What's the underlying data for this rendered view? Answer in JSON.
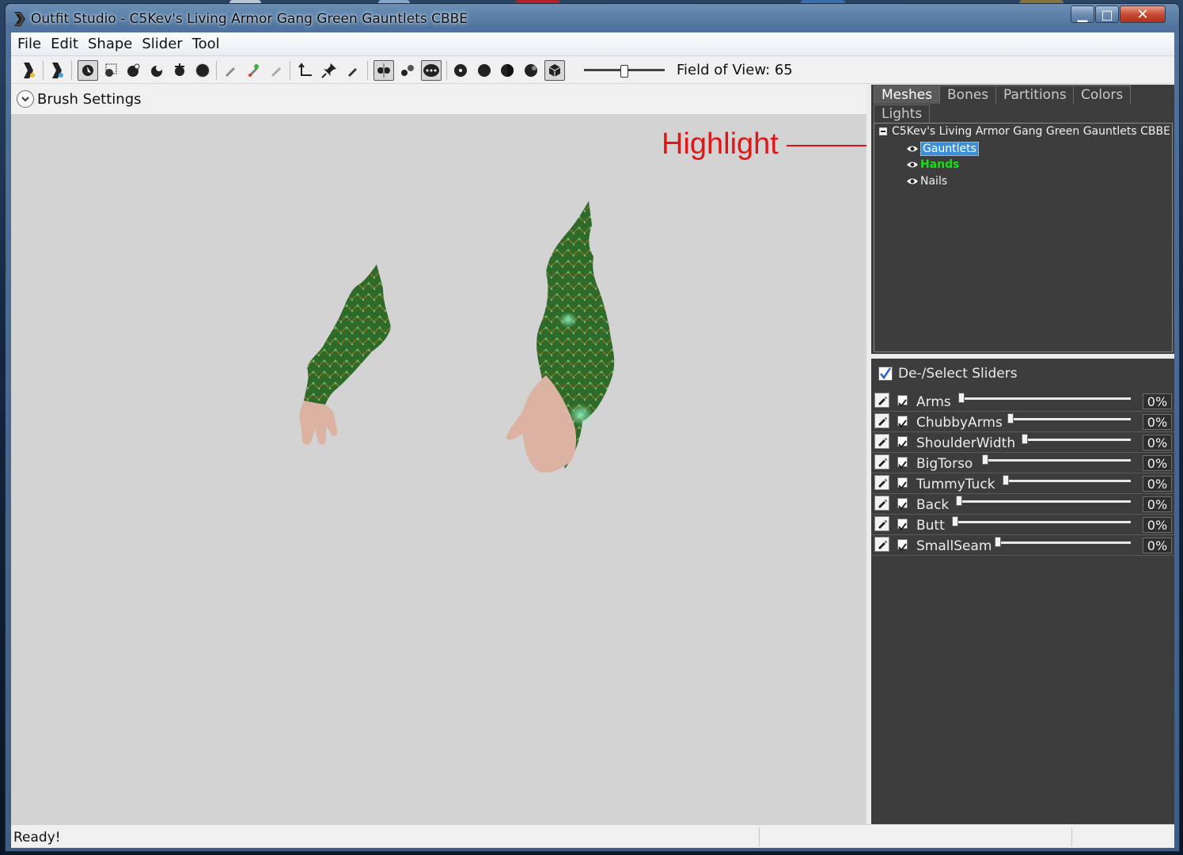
{
  "window": {
    "title": "Outfit Studio - C5Kev's Living Armor Gang Green Gauntlets CBBE",
    "min_symbol": "▁",
    "max_symbol": "□",
    "close_symbol": "✕"
  },
  "menu": [
    "File",
    "Edit",
    "Shape",
    "Slider",
    "Tool"
  ],
  "toolbar": {
    "field_of_view_label": "Field of View: 65",
    "field_of_view_value": 65
  },
  "brush_settings": {
    "label": "Brush Settings"
  },
  "annotation": {
    "text": "Highlight",
    "color": "#e01515"
  },
  "tabs": [
    "Meshes",
    "Bones",
    "Partitions",
    "Colors",
    "Lights"
  ],
  "mesh_tree": {
    "root": "C5Kev's Living Armor Gang Green Gauntlets CBBE",
    "children": [
      {
        "label": "Gauntlets",
        "state": "selected"
      },
      {
        "label": "Hands",
        "state": "active-green"
      },
      {
        "label": "Nails",
        "state": "normal"
      }
    ]
  },
  "sliders": {
    "header": "De-/Select Sliders",
    "items": [
      {
        "name": "Arms",
        "value": "0%",
        "checked": true,
        "position": 0
      },
      {
        "name": "ChubbyArms",
        "value": "0%",
        "checked": true,
        "position": 0
      },
      {
        "name": "ShoulderWidth",
        "value": "0%",
        "checked": true,
        "position": 0
      },
      {
        "name": "BigTorso",
        "value": "0%",
        "checked": true,
        "position": 0
      },
      {
        "name": "TummyTuck",
        "value": "0%",
        "checked": true,
        "position": 0
      },
      {
        "name": "Back",
        "value": "0%",
        "checked": true,
        "position": 0
      },
      {
        "name": "Butt",
        "value": "0%",
        "checked": true,
        "position": 0
      },
      {
        "name": "SmallSeam",
        "value": "0%",
        "checked": true,
        "position": 0
      }
    ]
  },
  "status": {
    "text": "Ready!"
  },
  "colors": {
    "viewport_bg": "#d3d3d3",
    "panel_bg": "#3c3c3c",
    "selection_blue": "#3a8fd9",
    "hands_green": "#17e017",
    "armor_green": "#2f6b2a",
    "skin": "#e0b8a8"
  }
}
